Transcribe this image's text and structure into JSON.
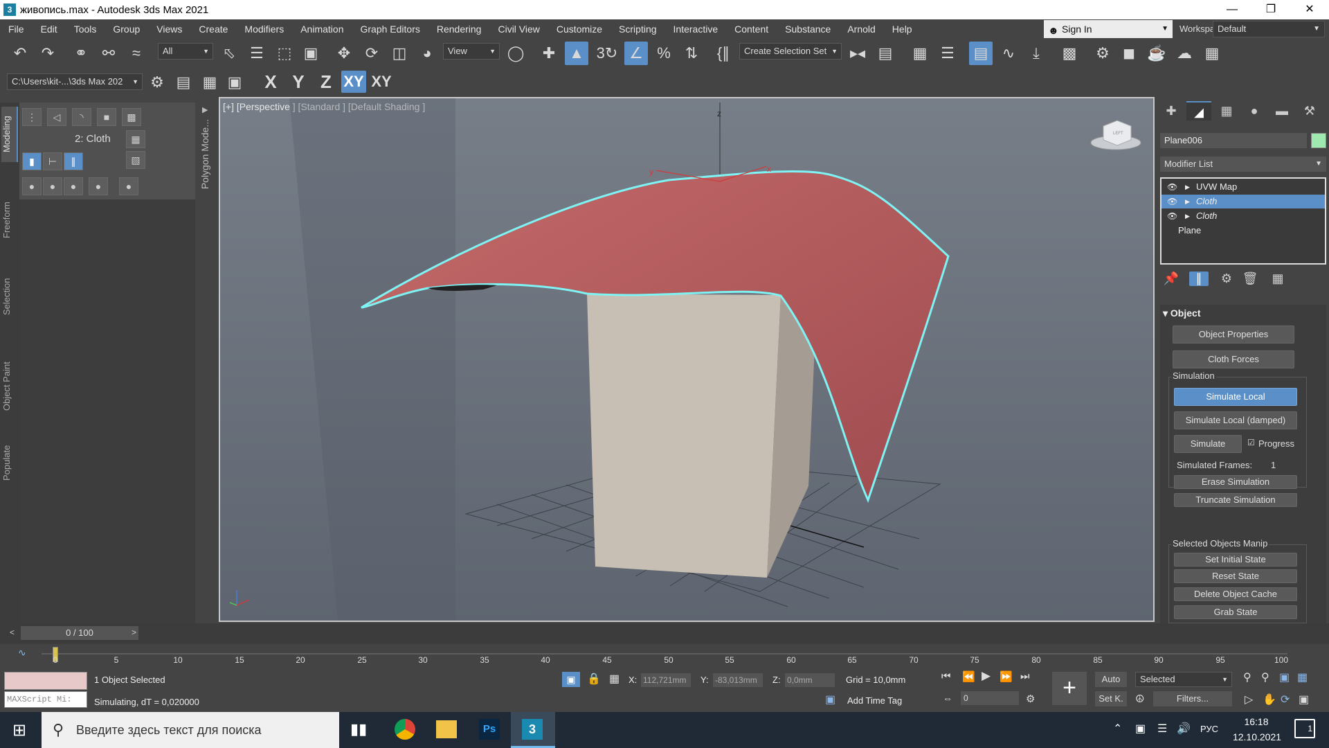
{
  "window": {
    "title": "живопись.max - Autodesk 3ds Max 2021",
    "app_icon": "3",
    "minimize": "—",
    "maximize": "❐",
    "close": "✕"
  },
  "menu": [
    "File",
    "Edit",
    "Tools",
    "Group",
    "Views",
    "Create",
    "Modifiers",
    "Animation",
    "Graph Editors",
    "Rendering",
    "Civil View",
    "Customize",
    "Scripting",
    "Interactive",
    "Content",
    "Substance",
    "Arnold",
    "Help"
  ],
  "signin": {
    "label": "Sign In"
  },
  "workspaces": {
    "label": "Workspaces:",
    "value": "Default"
  },
  "toolbar": {
    "filter_value": "All",
    "refcoord_value": "View",
    "selset_value": "Create Selection Set",
    "path_value": "C:\\Users\\kit-...\\3ds Max 202",
    "axes": [
      "X",
      "Y",
      "Z",
      "XY",
      "XY"
    ]
  },
  "left_tabs": [
    "Modeling",
    "Freeform",
    "Selection",
    "Object Paint",
    "Populate"
  ],
  "ribbon": {
    "label": "2: Cloth",
    "polymode": "Polygon Mode..."
  },
  "viewport": {
    "label": "[+] [Perspective ] [Standard ] [Default Shading ]",
    "axis_z": "z",
    "axis_x": "x",
    "axis_y": "y",
    "viewcube_label": "LEFT"
  },
  "command_panel": {
    "object_name": "Plane006",
    "object_color": "#9fe8b0",
    "modifier_list": "Modifier List",
    "stack": [
      {
        "label": "UVW Map",
        "italic": false,
        "selected": false
      },
      {
        "label": "Cloth",
        "italic": true,
        "selected": true
      },
      {
        "label": "Cloth",
        "italic": true,
        "selected": false
      },
      {
        "label": "Plane",
        "italic": false,
        "selected": false
      }
    ],
    "rollout": {
      "title": "Object",
      "object_properties": "Object Properties",
      "cloth_forces": "Cloth Forces",
      "simulation_group": "Simulation",
      "simulate_local": "Simulate Local",
      "simulate_local_damped": "Simulate Local (damped)",
      "simulate": "Simulate",
      "progress_label": "Progress",
      "progress_checked": true,
      "simulated_frames_label": "Simulated Frames:",
      "simulated_frames_value": "1",
      "erase_simulation": "Erase Simulation",
      "truncate_simulation": "Truncate Simulation",
      "selected_objects_group": "Selected Objects Manip",
      "set_initial_state": "Set Initial State",
      "reset_state": "Reset State",
      "delete_object_cache": "Delete Object Cache",
      "grab_state": "Grab State"
    }
  },
  "timeline": {
    "slider": "0 / 100",
    "prev": "<",
    "next": ">",
    "ticks": [
      "0",
      "5",
      "10",
      "15",
      "20",
      "25",
      "30",
      "35",
      "40",
      "45",
      "50",
      "55",
      "60",
      "65",
      "70",
      "75",
      "80",
      "85",
      "90",
      "95",
      "100"
    ]
  },
  "status": {
    "maxscript": "MAXScript Mi:",
    "selected": "1 Object Selected",
    "prompt": "Simulating, dT = 0,020000",
    "x_label": "X:",
    "x_value": "112,721mm",
    "y_label": "Y:",
    "y_value": "-83,013mm",
    "z_label": "Z:",
    "z_value": "0,0mm",
    "grid": "Grid = 10,0mm",
    "add_time_tag": "Add Time Tag",
    "auto": "Auto",
    "setk": "Set K.",
    "selected_dd": "Selected",
    "filters": "Filters...",
    "frame": "0"
  },
  "taskbar": {
    "search_placeholder": "Введите здесь текст для поиска",
    "lang": "РУС",
    "time": "16:18",
    "date": "12.10.2021",
    "notif": "1"
  }
}
